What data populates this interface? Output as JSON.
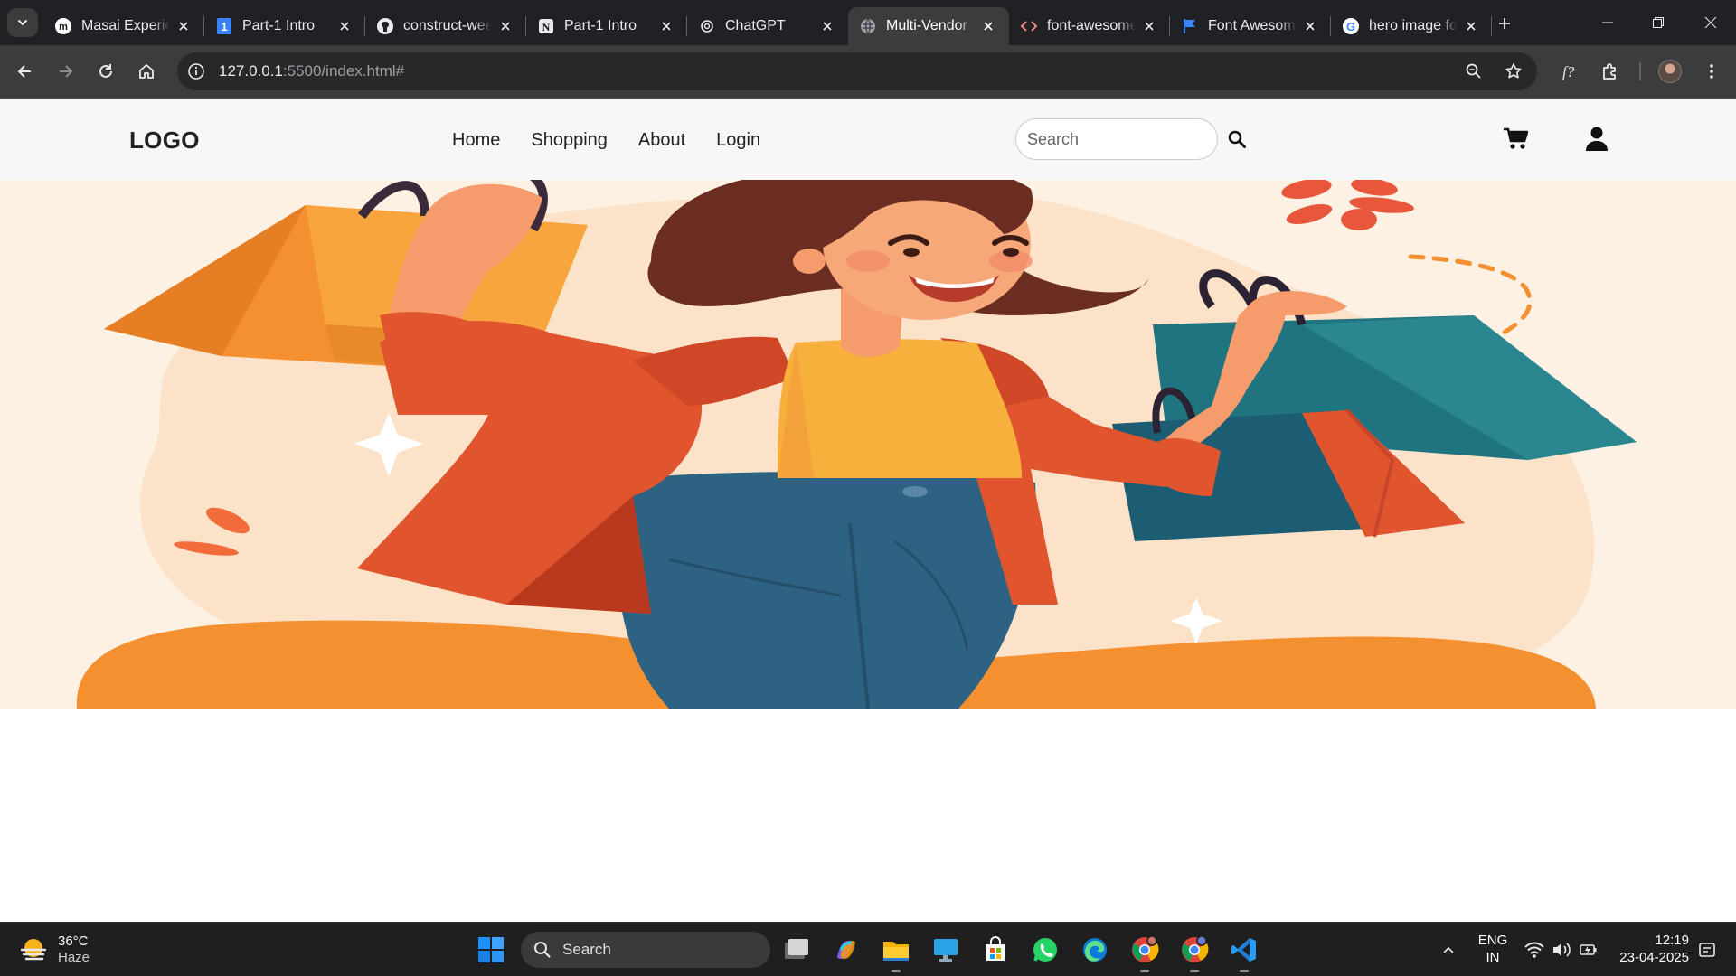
{
  "browser": {
    "tabs": [
      {
        "title": "Masai Experience",
        "favicon": "masai-icon",
        "active": false
      },
      {
        "title": "Part-1 Intro",
        "favicon": "number-one-icon",
        "active": false
      },
      {
        "title": "construct-week",
        "favicon": "github-icon",
        "active": false
      },
      {
        "title": "Part-1 Intro",
        "favicon": "notion-icon",
        "active": false
      },
      {
        "title": "ChatGPT",
        "favicon": "chatgpt-icon",
        "active": false
      },
      {
        "title": "Multi-Vendor",
        "favicon": "globe-icon",
        "active": true
      },
      {
        "title": "font-awesome",
        "favicon": "code-icon",
        "active": false
      },
      {
        "title": "Font Awesome",
        "favicon": "flag-icon",
        "active": false
      },
      {
        "title": "hero image for",
        "favicon": "google-icon",
        "active": false
      }
    ],
    "url_host": "127.0.0.1",
    "url_path": ":5500/index.html#"
  },
  "site": {
    "logo": "LOGO",
    "nav": [
      "Home",
      "Shopping",
      "About",
      "Login"
    ],
    "search_placeholder": "Search",
    "hero_image": "shopping-woman-illustration"
  },
  "taskbar": {
    "weather_temp": "36°C",
    "weather_cond": "Haze",
    "search_label": "Search",
    "lang_line1": "ENG",
    "lang_line2": "IN",
    "time": "12:19",
    "date": "23-04-2025",
    "apps": [
      "task-view-icon",
      "copilot-icon",
      "file-explorer-icon",
      "remote-desktop-icon",
      "microsoft-store-icon",
      "whatsapp-icon",
      "edge-icon",
      "chrome-icon",
      "chrome-profile-icon",
      "vscode-icon"
    ]
  },
  "colors": {
    "hero_bg": "#fdf1e4",
    "accent_orange": "#f28a2e",
    "jacket": "#e0542e",
    "shirt": "#f7b03c",
    "jeans": "#2d6283",
    "teal_bag": "#1f7480"
  }
}
